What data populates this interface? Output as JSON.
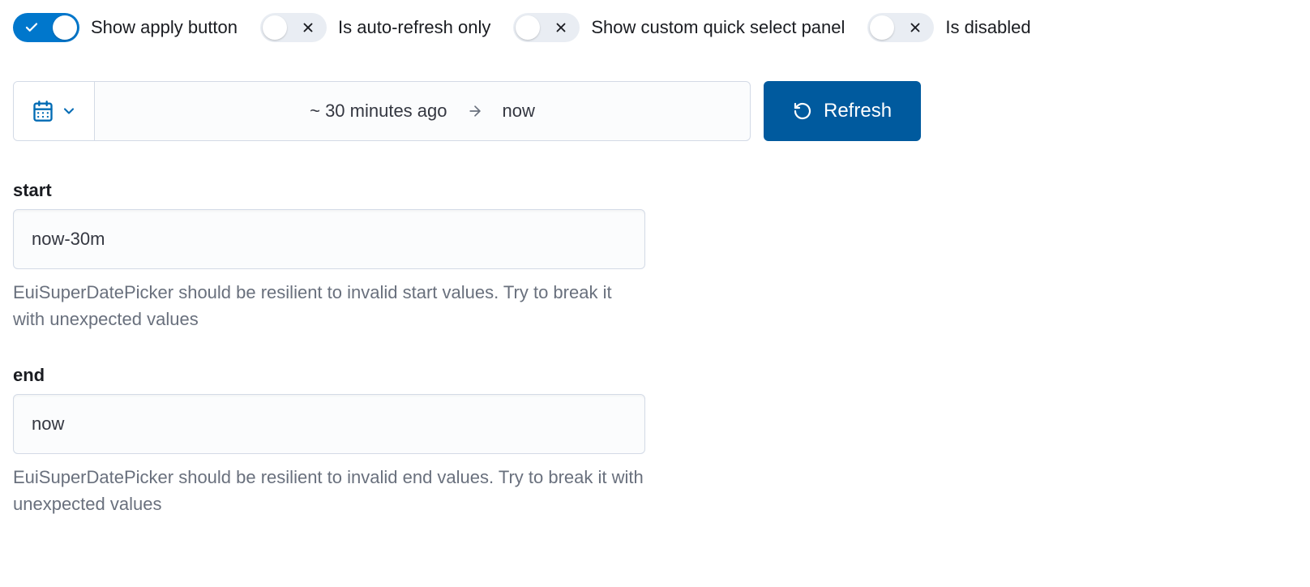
{
  "toggles": {
    "showApply": {
      "label": "Show apply button",
      "on": true
    },
    "autoRefreshOnly": {
      "label": "Is auto-refresh only",
      "on": false
    },
    "customQuickSelect": {
      "label": "Show custom quick select panel",
      "on": false
    },
    "isDisabled": {
      "label": "Is disabled",
      "on": false
    }
  },
  "datePicker": {
    "rangeStart": "~ 30 minutes ago",
    "rangeEnd": "now",
    "refreshLabel": "Refresh"
  },
  "form": {
    "start": {
      "label": "start",
      "value": "now-30m",
      "help": "EuiSuperDatePicker should be resilient to invalid start values. Try to break it with unexpected values"
    },
    "end": {
      "label": "end",
      "value": "now",
      "help": "EuiSuperDatePicker should be resilient to invalid end values. Try to break it with unexpected values"
    }
  }
}
